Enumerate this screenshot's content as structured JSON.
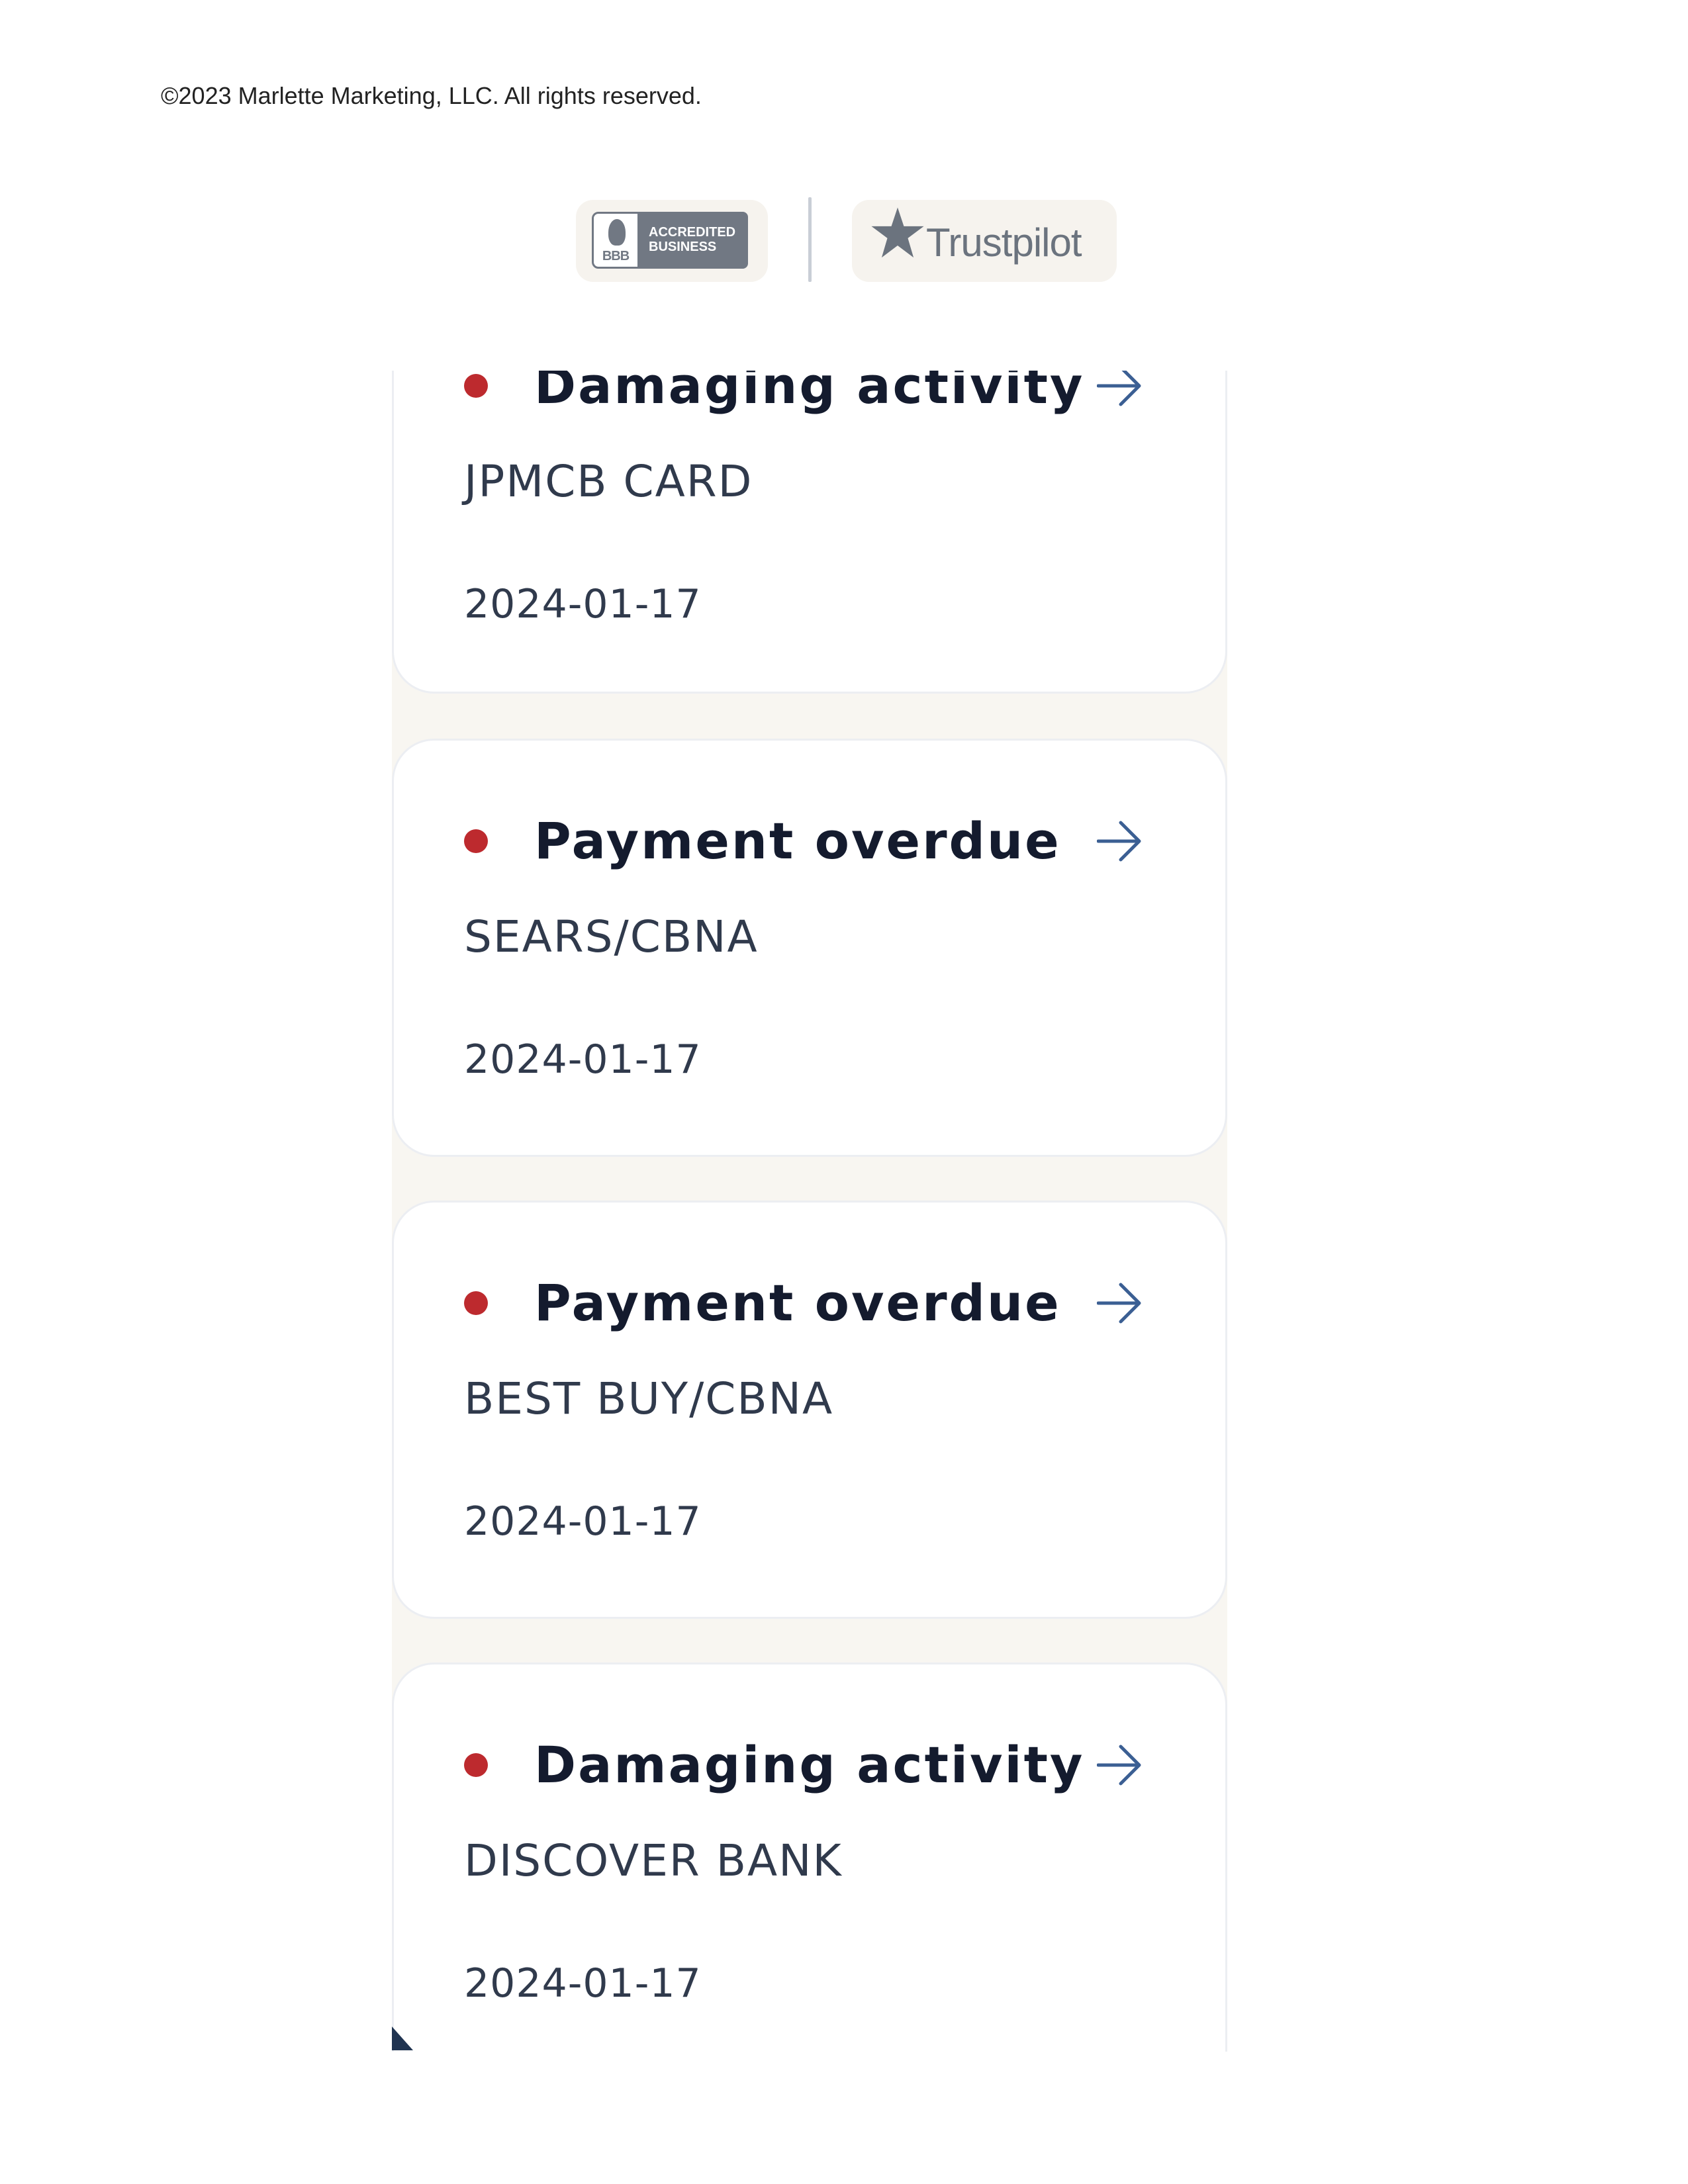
{
  "footer": {
    "copyright": "©2023 Marlette Marketing, LLC. All rights reserved."
  },
  "badges": {
    "bbb": {
      "seal_text": "BBB",
      "line1": "ACCREDITED",
      "line2": "BUSINESS"
    },
    "trustpilot": {
      "label": "Trustpilot"
    }
  },
  "alerts": [
    {
      "title": "Damaging activity",
      "account": "JPMCB CARD",
      "date": "2024-01-17"
    },
    {
      "title": "Payment overdue",
      "account": "SEARS/CBNA",
      "date": "2024-01-17"
    },
    {
      "title": "Payment overdue",
      "account": "BEST BUY/CBNA",
      "date": "2024-01-17"
    },
    {
      "title": "Damaging activity",
      "account": "DISCOVER BANK",
      "date": "2024-01-17"
    }
  ],
  "colors": {
    "status_dot": "#bd2a2e",
    "arrow": "#3b5f93",
    "panel_bg": "#f8f6f1",
    "title_text": "#141b2e"
  },
  "icons": {
    "status": "red-dot-icon",
    "row_action": "arrow-right-icon",
    "bbb": "bbb-torch-icon",
    "trustpilot": "star-icon"
  }
}
